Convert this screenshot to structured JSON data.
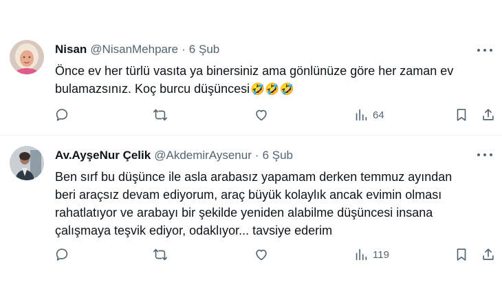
{
  "tweets": [
    {
      "name": "Nisan",
      "handle": "@NisanMehpare",
      "date": "6 Şub",
      "lines": [
        "Önce ev her türlü vasıta ya binersiniz ama gönlünüze göre her zaman ev",
        "bulamazsınız. Koç burcu düşüncesi"
      ],
      "emojis": "🤣🤣🤣",
      "views": "64",
      "avatar_color": "#e8b4a8"
    },
    {
      "name": "Av.AyşeNur Çelik",
      "handle": "@AkdemirAysenur",
      "date": "6 Şub",
      "lines": [
        "Ben sırf bu düşünce ile asla arabasız yapamam derken temmuz ayından",
        "beri araçsız devam ediyorum, araç büyük kolaylık ancak evimin olması",
        "rahatlatıyor ve arabayı bir şekilde yeniden alabilme düşüncesi insana",
        "çalışmaya teşvik ediyor, odaklıyor... tavsiye ederim"
      ],
      "views": "119",
      "avatar_color": "#9fb0b8"
    }
  ],
  "icons": {
    "reply": "reply-icon",
    "retweet": "retweet-icon",
    "like": "like-icon",
    "views": "views-icon",
    "bookmark": "bookmark-icon",
    "share": "share-icon",
    "more": "more-icon"
  },
  "colors": {
    "text": "#0f1419",
    "secondary": "#536471",
    "divider": "#eff3f4"
  }
}
